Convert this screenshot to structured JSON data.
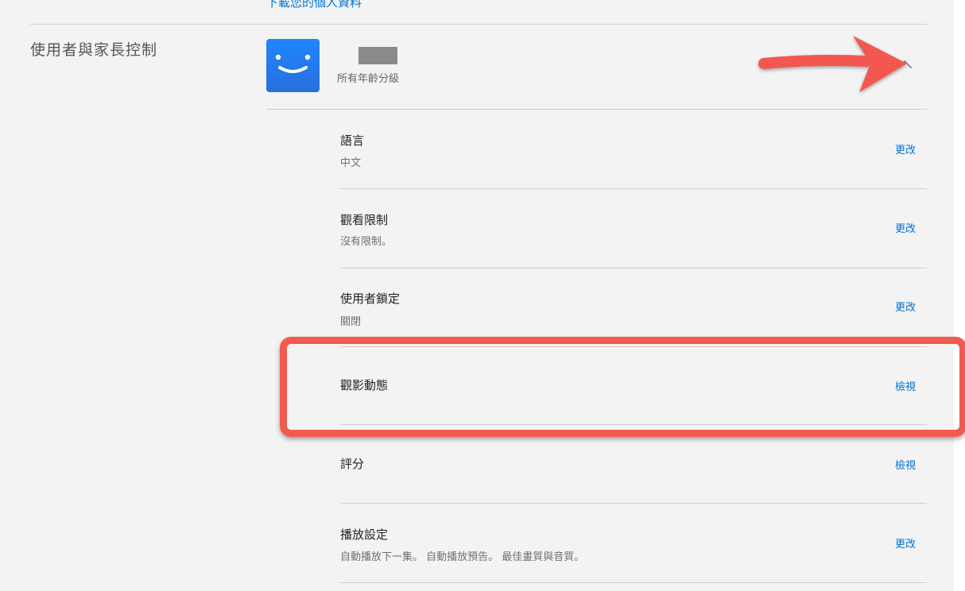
{
  "top_link": "下載您的個人資料",
  "section": {
    "title": "使用者與家長控制"
  },
  "profile": {
    "avatar_icon": "smiley-face-icon",
    "rating": "所有年齡分級",
    "expand_icon": "chevron-up-icon"
  },
  "settings": [
    {
      "label": "語言",
      "value": "中文",
      "action": "更改"
    },
    {
      "label": "觀看限制",
      "value": "沒有限制。",
      "action": "更改"
    },
    {
      "label": "使用者鎖定",
      "value": "關閉",
      "action": "更改"
    },
    {
      "label": "觀影動態",
      "value": "",
      "action": "檢視"
    },
    {
      "label": "評分",
      "value": "",
      "action": "檢視"
    },
    {
      "label": "播放設定",
      "value": "自動播放下一集。 自動播放預告。 最佳畫質與音質。",
      "action": "更改"
    }
  ],
  "colors": {
    "accent": "#0073d6",
    "annotation": "#f2594f",
    "background": "#f3f3f3"
  }
}
